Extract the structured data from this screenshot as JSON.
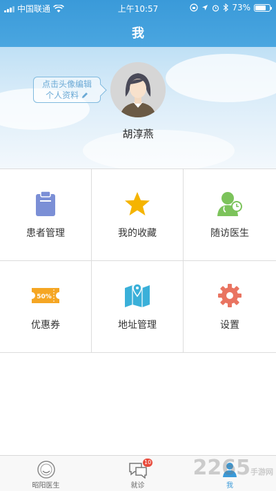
{
  "status_bar": {
    "carrier": "中国联通",
    "time": "上午10:57",
    "battery_percent": "73%"
  },
  "nav": {
    "title": "我"
  },
  "profile": {
    "tip_line1": "点击头像编辑",
    "tip_line2": "个人资料",
    "username": "胡淳燕"
  },
  "menu": [
    {
      "label": "患者管理",
      "icon": "clipboard-icon",
      "color": "#7b8fd6"
    },
    {
      "label": "我的收藏",
      "icon": "star-icon",
      "color": "#f5b400"
    },
    {
      "label": "随访医生",
      "icon": "doctor-icon",
      "color": "#7cc35b"
    },
    {
      "label": "优惠券",
      "icon": "coupon-icon",
      "color": "#f5a623"
    },
    {
      "label": "地址管理",
      "icon": "map-icon",
      "color": "#3ab0d9"
    },
    {
      "label": "设置",
      "icon": "gear-icon",
      "color": "#e97461"
    }
  ],
  "coupon_text": "50%",
  "tabs": [
    {
      "label": "昭阳医生",
      "active": false
    },
    {
      "label": "就诊",
      "active": false,
      "badge": "10"
    },
    {
      "label": "我",
      "active": true
    }
  ],
  "watermark": {
    "main": "2265",
    "sub": "手游网"
  },
  "colors": {
    "accent": "#3a9ad9",
    "badge": "#e84b3c"
  }
}
